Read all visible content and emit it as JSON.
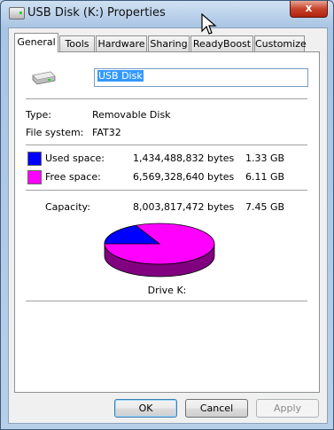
{
  "window": {
    "title": "USB Disk (K:) Properties",
    "close_glyph": "x"
  },
  "tabs": [
    {
      "label": "General",
      "active": true
    },
    {
      "label": "Tools"
    },
    {
      "label": "Hardware"
    },
    {
      "label": "Sharing"
    },
    {
      "label": "ReadyBoost"
    },
    {
      "label": "Customize"
    }
  ],
  "drive": {
    "name": "USB Disk",
    "type_label": "Type:",
    "type_value": "Removable Disk",
    "fs_label": "File system:",
    "fs_value": "FAT32"
  },
  "space": {
    "used_label": "Used space:",
    "used_bytes": "1,434,488,832 bytes",
    "used_size": "1.33 GB",
    "free_label": "Free space:",
    "free_bytes": "6,569,328,640 bytes",
    "free_size": "6.11 GB",
    "capacity_label": "Capacity:",
    "capacity_bytes": "8,003,817,472 bytes",
    "capacity_size": "7.45 GB",
    "used_color": "#0000ff",
    "free_color": "#ff00ff"
  },
  "pie": {
    "caption": "Drive K:",
    "used_fraction": 0.179
  },
  "buttons": {
    "ok": "OK",
    "cancel": "Cancel",
    "apply": "Apply"
  }
}
